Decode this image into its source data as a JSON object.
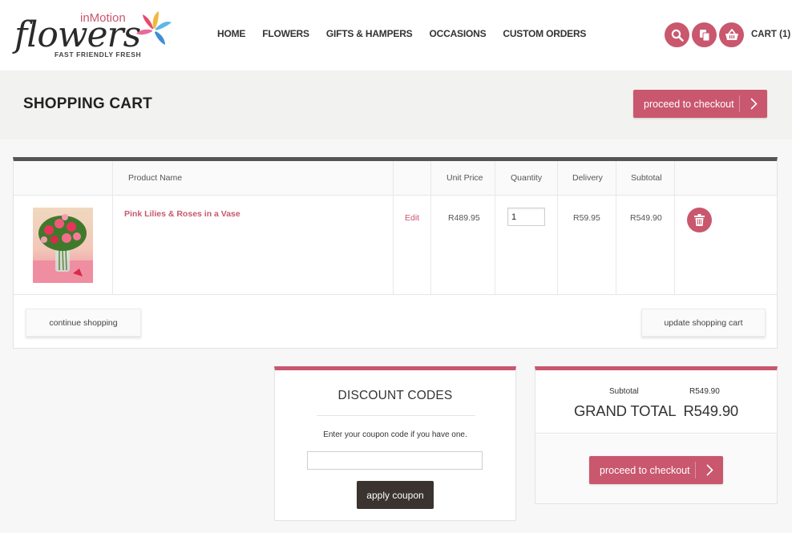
{
  "brand": {
    "name_top": "inMotion",
    "name_main": "flowers",
    "tagline": "FAST FRIENDLY FRESH"
  },
  "nav": {
    "items": [
      "HOME",
      "FLOWERS",
      "GIFTS & HAMPERS",
      "OCCASIONS",
      "CUSTOM ORDERS"
    ]
  },
  "header": {
    "icons": [
      "search-icon",
      "copy-icon",
      "basket-icon"
    ],
    "cart_label": "CART (1)"
  },
  "page": {
    "title": "SHOPPING CART",
    "checkout_label": "proceed to checkout"
  },
  "cart": {
    "columns": {
      "product_name": "Product Name",
      "unit_price": "Unit Price",
      "quantity": "Quantity",
      "delivery": "Delivery",
      "subtotal": "Subtotal"
    },
    "items": [
      {
        "name": "Pink Lilies & Roses in a Vase",
        "edit_label": "Edit",
        "unit_price": "R489.95",
        "quantity": "1",
        "delivery": "R59.95",
        "subtotal": "R549.90"
      }
    ],
    "continue_label": "continue shopping",
    "update_label": "update shopping cart"
  },
  "discount": {
    "title": "DISCOUNT CODES",
    "instructions": "Enter your coupon code if you have one.",
    "input_value": "",
    "apply_label": "apply coupon"
  },
  "totals": {
    "subtotal_label": "Subtotal",
    "subtotal_value": "R549.90",
    "grand_total": "GRAND TOTAL  R549.90",
    "checkout_label": "proceed to checkout"
  },
  "colors": {
    "accent": "#c9576e",
    "dark_button": "#3a3330",
    "table_top_border": "#555555"
  }
}
